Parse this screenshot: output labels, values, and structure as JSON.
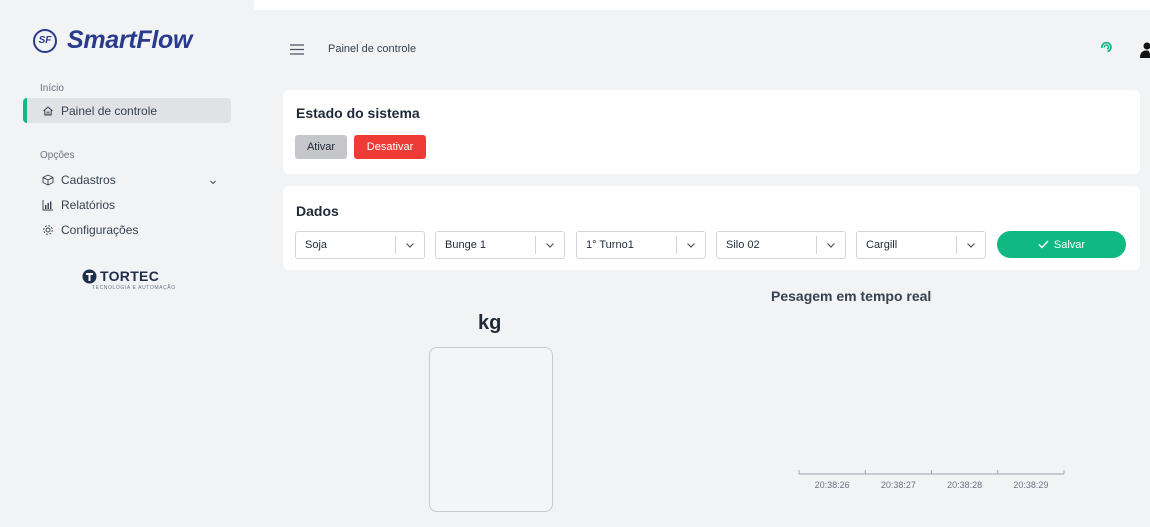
{
  "app": {
    "brand": "SmartFlow",
    "brand_mark": "SF"
  },
  "sidebar": {
    "section_inicio": "Início",
    "active_item": "Painel de controle",
    "section_opcoes": "Opções",
    "items": [
      {
        "label": "Cadastros",
        "icon": "cube-icon",
        "has_submenu": true
      },
      {
        "label": "Relatórios",
        "icon": "bar-chart-icon"
      },
      {
        "label": "Configurações",
        "icon": "gear-icon"
      }
    ],
    "partner_logo": "TORTEC",
    "partner_tagline": "TECNOLOGIA E AUTOMAÇÃO"
  },
  "header": {
    "title": "Painel de controle"
  },
  "estado": {
    "title": "Estado do sistema",
    "ativar_label": "Ativar",
    "desativar_label": "Desativar"
  },
  "dados": {
    "title": "Dados",
    "selects": [
      {
        "name": "produto",
        "value": "Soja"
      },
      {
        "name": "cliente",
        "value": "Bunge 1"
      },
      {
        "name": "turno",
        "value": "1° Turno1"
      },
      {
        "name": "silo",
        "value": "Silo 02"
      },
      {
        "name": "destino",
        "value": "Cargill"
      }
    ],
    "save_label": "Salvar"
  },
  "weight": {
    "unit": "kg"
  },
  "chart_data": {
    "type": "line",
    "title": "Pesagem em tempo real",
    "categories": [
      "20:38:26",
      "20:38:27",
      "20:38:28",
      "20:38:29"
    ],
    "series": [],
    "grid": false
  },
  "colors": {
    "accent": "#10b981",
    "danger": "#ef3b36",
    "brand": "#2a3a8c",
    "neutral_button": "#c4c6ca"
  }
}
